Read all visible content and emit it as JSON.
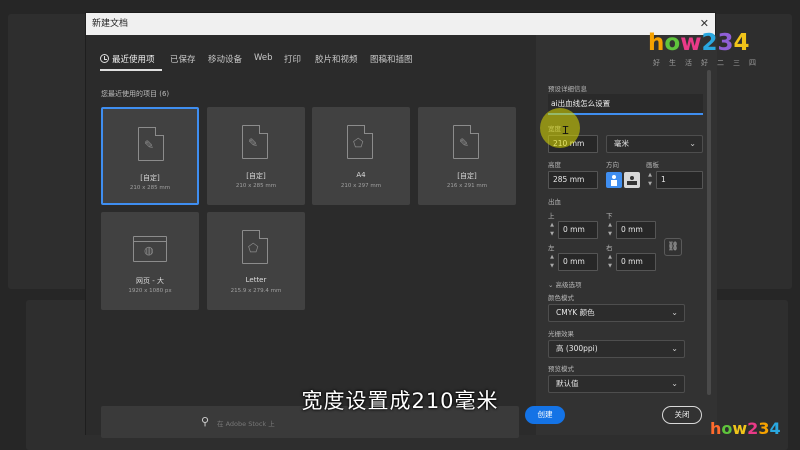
{
  "dialog": {
    "title": "新建文档",
    "close_glyph": "✕"
  },
  "tabs": [
    {
      "label": "最近使用项",
      "active": true
    },
    {
      "label": "已保存"
    },
    {
      "label": "移动设备"
    },
    {
      "label": "Web"
    },
    {
      "label": "打印"
    },
    {
      "label": "胶片和视频"
    },
    {
      "label": "图稿和插图"
    }
  ],
  "recent": {
    "title": "您最近使用的项目 (6)",
    "items": [
      {
        "name": "[自定]",
        "size": "210 x 285 mm",
        "icon": "custom-doc-icon",
        "selected": true
      },
      {
        "name": "[自定]",
        "size": "210 x 285 mm",
        "icon": "custom-doc-icon"
      },
      {
        "name": "A4",
        "size": "210 x 297 mm",
        "icon": "print-doc-icon"
      },
      {
        "name": "[自定]",
        "size": "216 x 291 mm",
        "icon": "custom-doc-icon"
      },
      {
        "name": "网页 - 大",
        "size": "1920 x 1080 px",
        "icon": "web-doc-icon"
      },
      {
        "name": "Letter",
        "size": "215.9 x 279.4 mm",
        "icon": "print-doc-icon"
      }
    ]
  },
  "search": {
    "placeholder": "在 Adobe Stock 上"
  },
  "preset": {
    "section_label": "预设详细信息",
    "name_value": "ai出血线怎么设置",
    "width_label": "宽度",
    "width_value": "210 mm",
    "unit_value": "毫米",
    "height_label": "高度",
    "height_value": "285 mm",
    "orientation_label": "方向",
    "artboards_label": "画板",
    "artboards_value": "1",
    "bleed_label": "出血",
    "bleed_top_label": "上",
    "bleed_top_value": "0 mm",
    "bleed_bottom_label": "下",
    "bleed_bottom_value": "0 mm",
    "bleed_left_label": "左",
    "bleed_left_value": "0 mm",
    "bleed_right_label": "右",
    "bleed_right_value": "0 mm",
    "advanced_label": "高级选项",
    "color_mode_label": "颜色模式",
    "color_mode_value": "CMYK 颜色",
    "raster_label": "光栅效果",
    "raster_value": "高 (300ppi)",
    "preview_label": "预览模式",
    "preview_value": "默认值"
  },
  "buttons": {
    "create": "创建",
    "close": "关闭"
  },
  "caption": "宽度设置成210毫米",
  "watermark": {
    "chars": [
      "h",
      "o",
      "w",
      "2",
      "3",
      "4"
    ],
    "sub": "好生活好二三四"
  },
  "colors": {
    "accent": "#1473e6",
    "selection": "#3f8ef0",
    "background": "#262626"
  }
}
